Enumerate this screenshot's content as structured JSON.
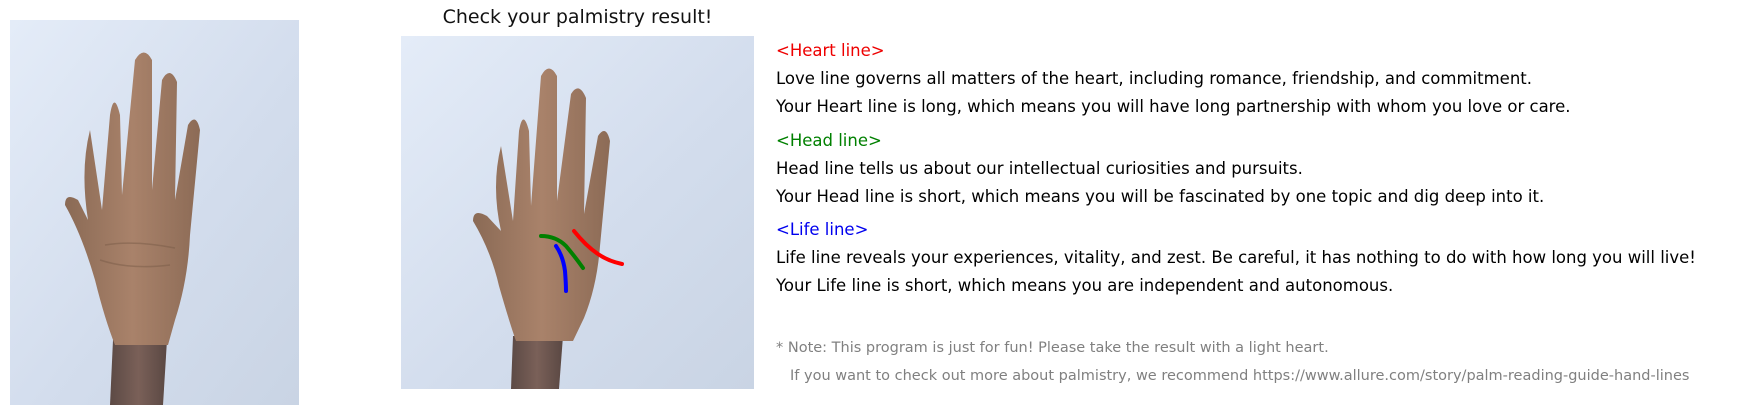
{
  "title": "Check your palmistry result!",
  "sections": [
    {
      "header": "<Heart line>",
      "color": "#ee0000",
      "lines": [
        "Love line governs all matters of the heart, including romance, friendship, and commitment.",
        "Your Heart line is long, which means you will have long partnership with whom you love or care."
      ]
    },
    {
      "header": "<Head line>",
      "color": "#008000",
      "lines": [
        "Head line tells us about our intellectual curiosities and pursuits.",
        "Your Head line is short, which means you will be fascinated by one topic and dig deep into it."
      ]
    },
    {
      "header": "<Life line>",
      "color": "#0000ee",
      "lines": [
        "Life line reveals your experiences, vitality, and zest. Be careful, it has nothing to do with how long you will live!",
        "Your Life line is short, which means you are independent and autonomous."
      ]
    }
  ],
  "note": {
    "line1": "* Note: This program is just for fun! Please take the result with a light heart.",
    "line2": "If you want to check out more about palmistry, we recommend https://www.allure.com/story/palm-reading-guide-hand-lines",
    "color": "#808080"
  },
  "overlay_colors": {
    "heart": "#ff0000",
    "head": "#008000",
    "life": "#0000ff"
  }
}
